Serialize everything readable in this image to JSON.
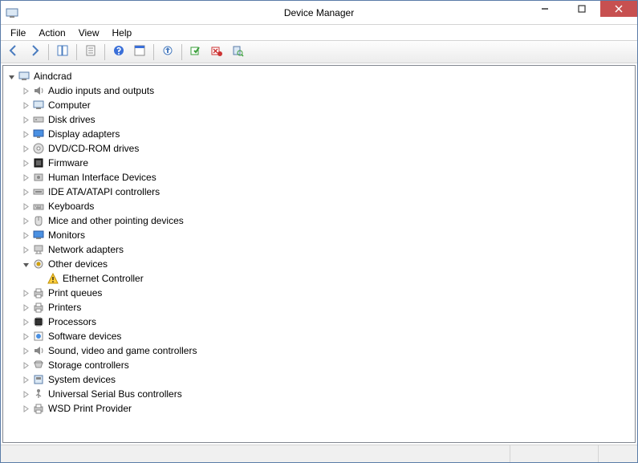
{
  "title": "Device Manager",
  "menus": [
    "File",
    "Action",
    "View",
    "Help"
  ],
  "toolbar": [
    {
      "name": "back-button",
      "icon": "arrow-left"
    },
    {
      "name": "forward-button",
      "icon": "arrow-right"
    },
    {
      "sep": true
    },
    {
      "name": "show-hide-console-tree-button",
      "icon": "console-tree"
    },
    {
      "sep": true
    },
    {
      "name": "properties-button",
      "icon": "properties"
    },
    {
      "sep": true
    },
    {
      "name": "help-button",
      "icon": "help"
    },
    {
      "name": "action-button",
      "icon": "action"
    },
    {
      "sep": true
    },
    {
      "name": "update-driver-button",
      "icon": "update-driver"
    },
    {
      "sep": true
    },
    {
      "name": "enable-button",
      "icon": "enable"
    },
    {
      "name": "uninstall-button",
      "icon": "uninstall"
    },
    {
      "name": "scan-hardware-button",
      "icon": "scan"
    }
  ],
  "tree": {
    "label": "Aindcrad",
    "icon": "computer",
    "expanded": true,
    "children": [
      {
        "label": "Audio inputs and outputs",
        "icon": "speaker"
      },
      {
        "label": "Computer",
        "icon": "computer"
      },
      {
        "label": "Disk drives",
        "icon": "disk"
      },
      {
        "label": "Display adapters",
        "icon": "display"
      },
      {
        "label": "DVD/CD-ROM drives",
        "icon": "dvd"
      },
      {
        "label": "Firmware",
        "icon": "firmware"
      },
      {
        "label": "Human Interface Devices",
        "icon": "hid"
      },
      {
        "label": "IDE ATA/ATAPI controllers",
        "icon": "ide"
      },
      {
        "label": "Keyboards",
        "icon": "keyboard"
      },
      {
        "label": "Mice and other pointing devices",
        "icon": "mouse"
      },
      {
        "label": "Monitors",
        "icon": "monitor"
      },
      {
        "label": "Network adapters",
        "icon": "network"
      },
      {
        "label": "Other devices",
        "icon": "other",
        "expanded": true,
        "children": [
          {
            "label": "Ethernet Controller",
            "icon": "warning",
            "leaf": true
          }
        ]
      },
      {
        "label": "Print queues",
        "icon": "printer"
      },
      {
        "label": "Printers",
        "icon": "printer"
      },
      {
        "label": "Processors",
        "icon": "cpu"
      },
      {
        "label": "Software devices",
        "icon": "software"
      },
      {
        "label": "Sound, video and game controllers",
        "icon": "speaker"
      },
      {
        "label": "Storage controllers",
        "icon": "storage"
      },
      {
        "label": "System devices",
        "icon": "system"
      },
      {
        "label": "Universal Serial Bus controllers",
        "icon": "usb"
      },
      {
        "label": "WSD Print Provider",
        "icon": "printer"
      }
    ]
  }
}
